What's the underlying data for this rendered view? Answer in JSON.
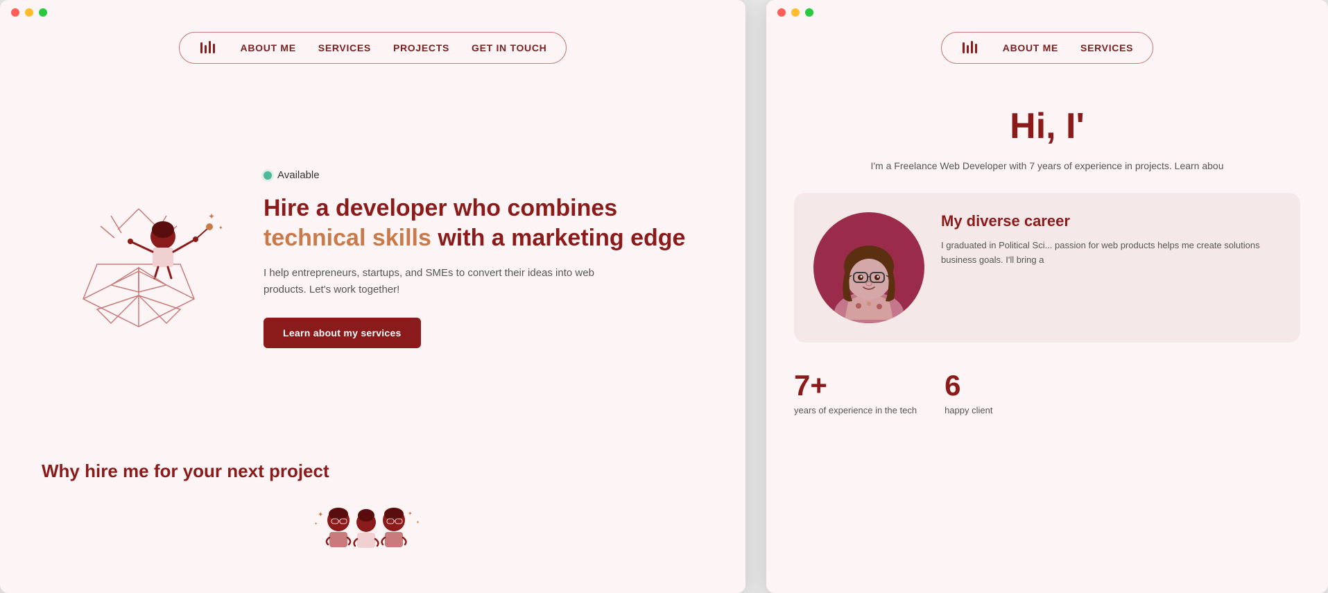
{
  "left_window": {
    "nav": {
      "logo_icon": "ℹ",
      "items": [
        {
          "label": "ABOUT ME",
          "id": "about"
        },
        {
          "label": "SERVICES",
          "id": "services"
        },
        {
          "label": "PROJECTS",
          "id": "projects"
        },
        {
          "label": "GET IN TOUCH",
          "id": "contact"
        }
      ]
    },
    "hero": {
      "available_text": "Available",
      "title_part1": "Hire a developer who combines",
      "title_part2": "technical skills",
      "title_part3": "with a marketing edge",
      "subtitle": "I help entrepreneurs, startups, and SMEs to convert their ideas into web products. Let's work together!",
      "cta_label": "Learn about my services"
    },
    "why_section": {
      "title": "Why hire me for your next project"
    }
  },
  "right_window": {
    "nav": {
      "logo_icon": "ℹ",
      "items": [
        {
          "label": "ABOUT ME",
          "id": "about"
        },
        {
          "label": "SERVICES",
          "id": "services"
        }
      ]
    },
    "hero": {
      "greeting": "Hi, I'",
      "intro": "I'm a Freelance Web Developer with 7 years of experience in projects. Learn abou"
    },
    "about_card": {
      "career_title": "My diverse career",
      "career_text": "I graduated in Political Sci... passion for web products helps me create solutions business goals. I'll bring a"
    },
    "stats": [
      {
        "number": "7+",
        "label": "years of experience in the tech"
      },
      {
        "number": "6",
        "label": "happy client"
      }
    ]
  },
  "colors": {
    "brand_dark": "#8b1a1a",
    "brand_medium": "#c97a4a",
    "brand_light": "#f5e8e8",
    "available_green": "#4db89a",
    "text_muted": "#555555"
  }
}
